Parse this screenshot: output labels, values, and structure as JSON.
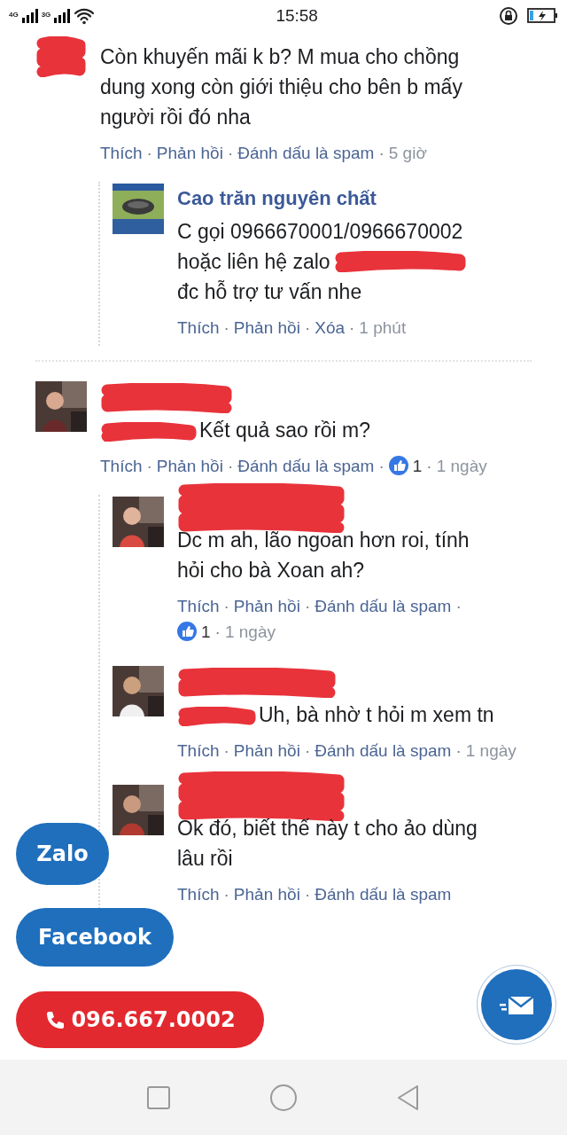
{
  "status_bar": {
    "network_1": "4G",
    "network_2": "3G",
    "time": "15:58"
  },
  "separator": "·",
  "comments": [
    {
      "kind": "name_hidden",
      "body": "Còn khuyến mãi k b? M mua cho chồng dung xong còn giới thiệu cho bên b mấy người rồi đó nha",
      "actions": [
        "Thích",
        "Phản hồi",
        "Đánh dấu là spam"
      ],
      "time": "5 giờ",
      "replies": [
        {
          "kind": "named",
          "author": "Cao trăn nguyên chất",
          "lines": [
            {
              "text": "C gọi 0966670001/0966670002",
              "redacted_after": false
            },
            {
              "text": "hoặc liên hệ zalo",
              "redacted_after": true
            },
            {
              "text": "đc hỗ trợ tư vấn nhe",
              "redacted_after": false
            }
          ],
          "actions": [
            "Thích",
            "Phản hồi",
            "Xóa"
          ],
          "time": "1 phút"
        }
      ]
    },
    {
      "kind": "name_inline",
      "body": "Kết quả sao rồi m?",
      "actions": [
        "Thích",
        "Phản hồi",
        "Đánh dấu là spam"
      ],
      "reactions": "1",
      "time": "1 ngày",
      "replies": [
        {
          "kind": "name_above",
          "body": "Dc m ah, lão ngoan hơn roi, tính hỏi cho bà Xoan ah?",
          "actions": [
            "Thích",
            "Phản hồi",
            "Đánh dấu là spam"
          ],
          "reactions": "1",
          "time": "1 ngày"
        },
        {
          "kind": "name_inline",
          "body": "Uh, bà nhờ t hỏi m xem tn",
          "actions": [
            "Thích",
            "Phản hồi",
            "Đánh dấu là spam"
          ],
          "time": "1 ngày"
        },
        {
          "kind": "name_above",
          "body": "Ok đó, biết thế này t cho ảo dùng lâu rồi",
          "actions": [
            "Thích",
            "Phản hồi",
            "Đánh dấu là spam"
          ]
        }
      ]
    }
  ],
  "floating_buttons": [
    {
      "kind": "pill",
      "label": "Zalo",
      "color": "#1f6fbd"
    },
    {
      "kind": "pill",
      "label": "Facebook",
      "color": "#1f6fbd"
    },
    {
      "kind": "phone",
      "label": "096.667.0002",
      "color": "#e2292f"
    },
    {
      "kind": "mail",
      "color": "#1f6fbd"
    }
  ]
}
